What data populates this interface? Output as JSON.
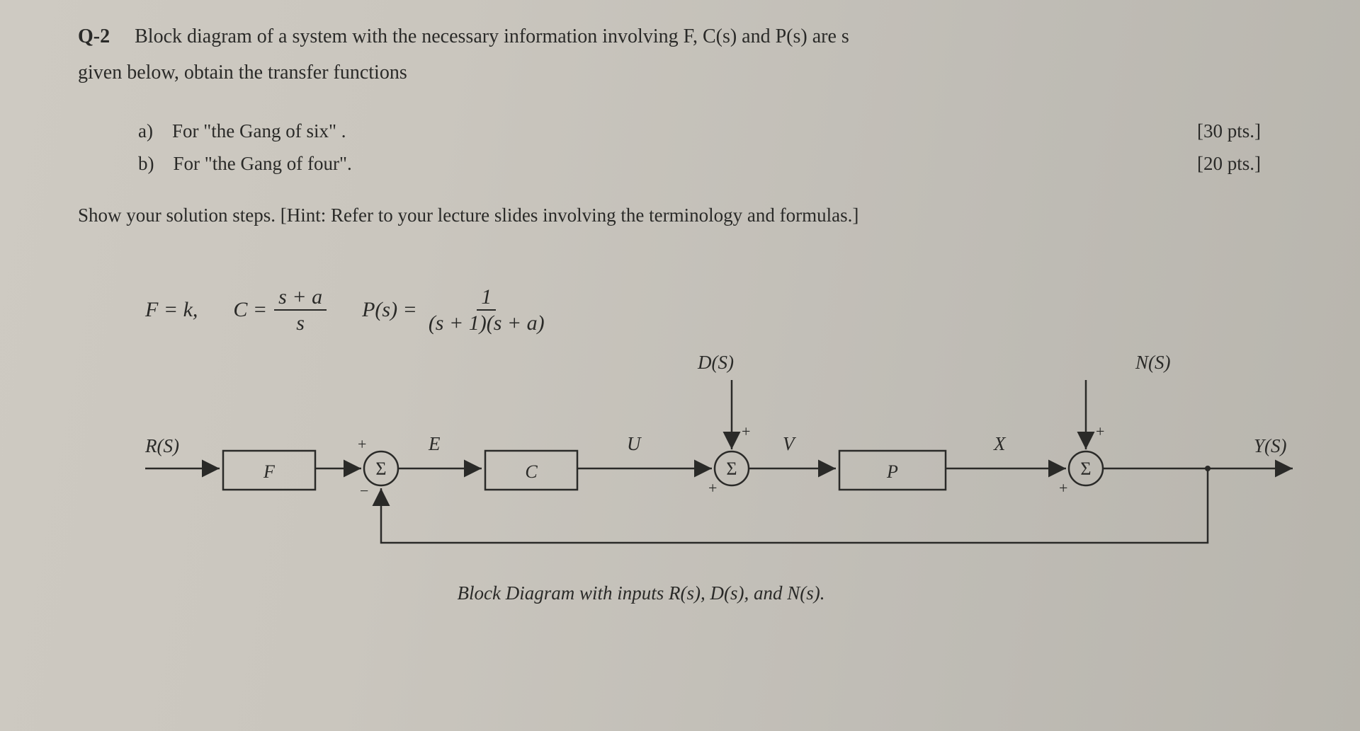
{
  "header": {
    "label": "Q-2",
    "text_line1": "Block diagram of a system with the necessary information involving F, C(s) and P(s) are s",
    "text_line2": "given below, obtain the transfer functions"
  },
  "subitems": {
    "a": {
      "letter": "a)",
      "text": "For \"the Gang of six\" .",
      "points": "[30 pts.]"
    },
    "b": {
      "letter": "b)",
      "text": "For \"the Gang of four\".",
      "points": "[20 pts.]"
    }
  },
  "hint": "Show your solution steps. [Hint: Refer to your lecture slides involving the terminology and formulas.]",
  "formulas": {
    "F_lhs": "F = k,",
    "C_lhs": "C =",
    "C_num": "s + a",
    "C_den": "s",
    "P_lhs": "P(s) =",
    "P_num": "1",
    "P_den": "(s + 1)(s + a)"
  },
  "signals": {
    "R": "R(S)",
    "E": "E",
    "U": "U",
    "V": "V",
    "X": "X",
    "D": "D(S)",
    "N": "N(S)",
    "Y": "Y(S)"
  },
  "blocks": {
    "F": "F",
    "C": "C",
    "P": "P",
    "Sigma": "Σ"
  },
  "signs": {
    "plus": "+",
    "minus": "−"
  },
  "caption": "Block Diagram with inputs   R(s), D(s), and N(s)."
}
